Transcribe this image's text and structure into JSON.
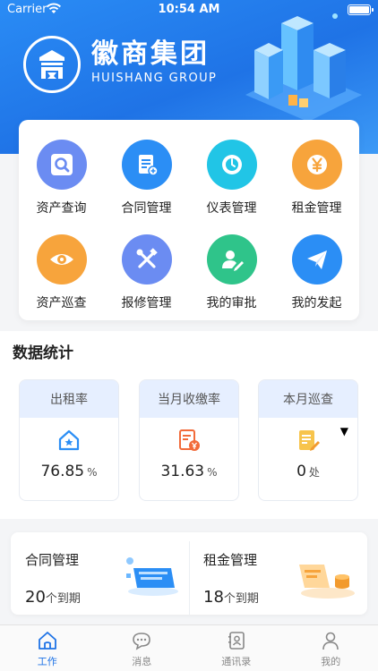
{
  "status_bar": {
    "carrier": "Carrier",
    "time": "10:54 AM"
  },
  "banner": {
    "brand_cn": "徽商集团",
    "brand_en": "HUISHANG GROUP"
  },
  "grid": [
    {
      "label": "资产查询",
      "icon": "search-doc-icon",
      "color": "#6b8cf2"
    },
    {
      "label": "合同管理",
      "icon": "contract-icon",
      "color": "#2b8ef5"
    },
    {
      "label": "仪表管理",
      "icon": "meter-icon",
      "color": "#21c5e6"
    },
    {
      "label": "租金管理",
      "icon": "yen-icon",
      "color": "#f7a43c"
    },
    {
      "label": "资产巡查",
      "icon": "eye-icon",
      "color": "#f7a43c"
    },
    {
      "label": "报修管理",
      "icon": "tools-icon",
      "color": "#6b8cf2"
    },
    {
      "label": "我的审批",
      "icon": "approval-user-icon",
      "color": "#2fc48a"
    },
    {
      "label": "我的发起",
      "icon": "paper-plane-icon",
      "color": "#2b8ef5"
    }
  ],
  "stats_title": "数据统计",
  "stats": [
    {
      "label": "出租率",
      "value": "76.85",
      "unit": "%"
    },
    {
      "label": "当月收缴率",
      "value": "31.63",
      "unit": "%"
    },
    {
      "label": "本月巡查",
      "value": "0",
      "unit": "处"
    }
  ],
  "summary": [
    {
      "title": "合同管理",
      "count": "20",
      "suffix": "个到期"
    },
    {
      "title": "租金管理",
      "count": "18",
      "suffix": "个到期"
    }
  ],
  "tabs": [
    {
      "label": "工作",
      "active": true
    },
    {
      "label": "消息"
    },
    {
      "label": "通讯录"
    },
    {
      "label": "我的"
    }
  ],
  "colors": {
    "primary": "#1f73e6",
    "stat_header": "#e6efff"
  }
}
